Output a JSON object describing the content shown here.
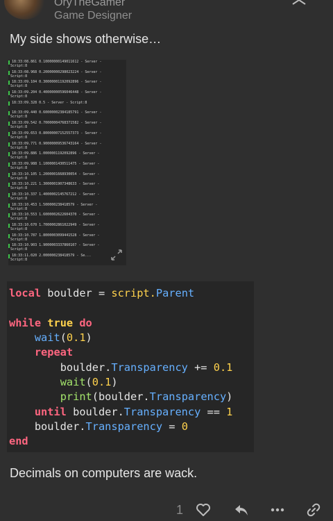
{
  "author": {
    "name": "OryTheGamer",
    "title": "Game Designer"
  },
  "post": {
    "text_top": "My side shows otherwise…",
    "text_bottom": "Decimals on computers are wack."
  },
  "console_log": [
    {
      "time": "18:33:08.861",
      "value": "0.10000000149011612",
      "suffix": " -  Server -",
      "line2": "Script:8"
    },
    {
      "time": "18:33:08.968",
      "value": "0.20000000298023224",
      "suffix": " -  Server -",
      "line2": "Script:8"
    },
    {
      "time": "18:33:09.104",
      "value": "0.30000001192092896",
      "suffix": " -  Server -",
      "line2": "Script:8"
    },
    {
      "time": "18:33:09.204",
      "value": "0.40000000596046448",
      "suffix": " -  Server -",
      "line2": "Script:8"
    },
    {
      "time": "18:33:09.328",
      "value": "0.5",
      "suffix": "  -  Server - Script:8",
      "line2": ""
    },
    {
      "time": "18:33:09.440",
      "value": "0.60000002384185791",
      "suffix": " -  Server -",
      "line2": "Script:8"
    },
    {
      "time": "18:33:09.542",
      "value": "0.70000004768371582",
      "suffix": " -  Server -",
      "line2": "Script:8"
    },
    {
      "time": "18:33:09.653",
      "value": "0.80000007152557373",
      "suffix": " -  Server -",
      "line2": "Script:8"
    },
    {
      "time": "18:33:09.771",
      "value": "0.90000009536743164",
      "suffix": " -  Server -",
      "line2": "Script:8"
    },
    {
      "time": "18:33:09.886",
      "value": "1.0000001192092896",
      "suffix": "  -  Server -",
      "line2": "Script:8"
    },
    {
      "time": "18:33:09.988",
      "value": "1.1000001430511475",
      "suffix": "  -  Server -",
      "line2": "Script:8"
    },
    {
      "time": "18:33:10.105",
      "value": "1.2000001668930054",
      "suffix": "  -  Server -",
      "line2": "Script:8"
    },
    {
      "time": "18:33:10.221",
      "value": "1.3000001907348633",
      "suffix": "  -  Server -",
      "line2": "Script:8"
    },
    {
      "time": "18:33:10.337",
      "value": "1.4000002145767212",
      "suffix": "  -  Server -",
      "line2": "Script:8"
    },
    {
      "time": "18:33:10.453",
      "value": "1.500000238418579",
      "suffix": "   -  Server -",
      "line2": "Script:8"
    },
    {
      "time": "18:33:10.553",
      "value": "1.6000002622604370",
      "suffix": "  -  Server -",
      "line2": "Script:8"
    },
    {
      "time": "18:33:10.670",
      "value": "1.7000002861022949",
      "suffix": "  -  Server -",
      "line2": "Script:8"
    },
    {
      "time": "18:33:10.787",
      "value": "1.8000003099441528",
      "suffix": "  -  Server -",
      "line2": "Script:8"
    },
    {
      "time": "18:33:10.903",
      "value": "1.9000003337860107",
      "suffix": "  -  Server -",
      "line2": "Script:8"
    },
    {
      "time": "18:33:11.020",
      "value": "2.000000238418579",
      "suffix": "   -  Se...",
      "line2": "Script:8"
    }
  ],
  "code": {
    "line1": {
      "kw": "local",
      "var": " boulder ",
      "op": "=",
      "obj": " script.",
      "prop": "Parent"
    },
    "line2": {
      "kw1": "while",
      "kw2": "true",
      "kw3": "do"
    },
    "line3": {
      "fn": "wait",
      "arg": "0.1"
    },
    "line4": {
      "kw": "repeat"
    },
    "line5": {
      "obj": "boulder.",
      "prop": "Transparency",
      "op": " += ",
      "num": "0.1"
    },
    "line6": {
      "fn": "wait",
      "arg": "0.1"
    },
    "line7": {
      "fn": "print",
      "obj": "boulder.",
      "prop": "Transparency"
    },
    "line8": {
      "kw": "until",
      "obj": " boulder.",
      "prop": "Transparency",
      "op": " == ",
      "num": "1"
    },
    "line9": {
      "obj": "boulder.",
      "prop": "Transparency",
      "op": " = ",
      "num": "0"
    },
    "line10": {
      "kw": "end"
    }
  },
  "actions": {
    "like_count": "1",
    "icons": [
      "heart-icon",
      "reply-icon",
      "more-icon",
      "link-icon"
    ]
  },
  "colors": {
    "background": "#2f2f2f",
    "code_bg": "#262626",
    "keyword": "#ff6680",
    "keyword_yellow": "#ffd24d",
    "property": "#66b0ff",
    "number": "#ffd24d",
    "console_bar": "#3dc44a"
  }
}
